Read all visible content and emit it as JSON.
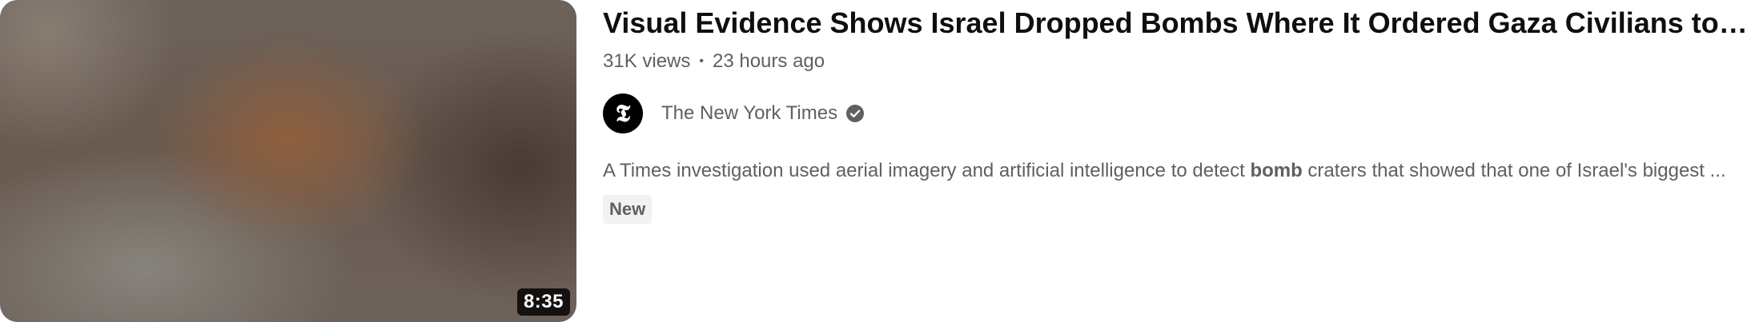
{
  "video": {
    "duration": "8:35",
    "title": "Visual Evidence Shows Israel Dropped Bombs Where It Ordered Gaza Civilians to Go",
    "views": "31K views",
    "meta_separator": "•",
    "age": "23 hours ago",
    "channel": {
      "name": "The New York Times",
      "avatar_glyph": "𝕿",
      "verified": true,
      "verified_icon": "check-circle-icon"
    },
    "description": {
      "before": "A Times investigation used aerial imagery and artificial intelligence to detect ",
      "highlight": "bomb",
      "after": " craters that showed that one of Israel's biggest ..."
    },
    "badge": "New"
  },
  "colors": {
    "title": "#0f0f0f",
    "secondary_text": "#606060",
    "badge_bg": "#f2f2f2",
    "duration_bg": "#000000"
  }
}
